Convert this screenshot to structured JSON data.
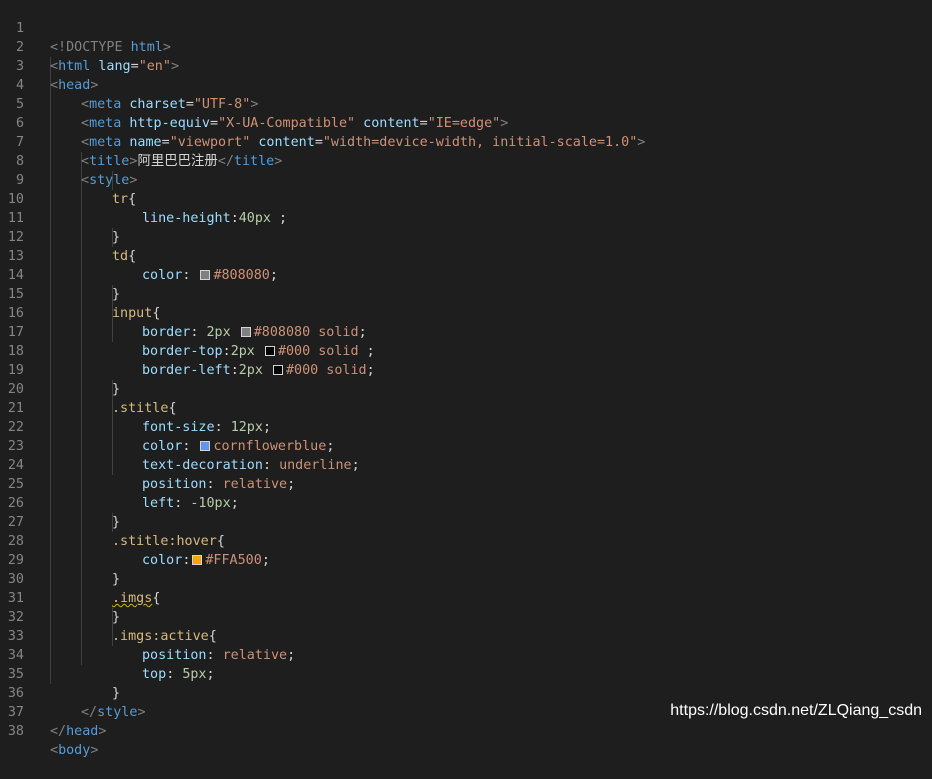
{
  "editor": {
    "line_numbers": [
      "1",
      "2",
      "3",
      "4",
      "5",
      "6",
      "7",
      "8",
      "9",
      "10",
      "11",
      "12",
      "13",
      "14",
      "15",
      "16",
      "17",
      "18",
      "19",
      "20",
      "21",
      "22",
      "23",
      "24",
      "25",
      "26",
      "27",
      "28",
      "29",
      "30",
      "31",
      "32",
      "33",
      "34",
      "35",
      "36",
      "37",
      "38"
    ],
    "colors": {
      "background": "#1e1e1e",
      "tag": "#569cd6",
      "attribute": "#9cdcfe",
      "string": "#ce9178",
      "number": "#b5cea8",
      "selector": "#d7ba7d",
      "text": "#d4d4d4",
      "line_number": "#858585"
    },
    "swatch_colors": {
      "gray": "#808080",
      "black": "#000",
      "cornflowerblue": "#6495ed",
      "orange": "#FFA500"
    },
    "t": {
      "l1_a": "<!DOCTYPE ",
      "l1_b": "html",
      "l1_c": ">",
      "l2_a": "<",
      "l2_b": "html",
      "l2_c": " lang",
      "l2_d": "=",
      "l2_e": "\"en\"",
      "l2_f": ">",
      "l3_a": "<",
      "l3_b": "head",
      "l3_c": ">",
      "l4_a": "<",
      "l4_b": "meta",
      "l4_c": " charset",
      "l4_d": "=",
      "l4_e": "\"UTF-8\"",
      "l4_f": ">",
      "l5_a": "<",
      "l5_b": "meta",
      "l5_c": " http-equiv",
      "l5_d": "=",
      "l5_e": "\"X-UA-Compatible\"",
      "l5_f": " content",
      "l5_g": "=",
      "l5_h": "\"IE=edge\"",
      "l5_i": ">",
      "l6_a": "<",
      "l6_b": "meta",
      "l6_c": " name",
      "l6_d": "=",
      "l6_e": "\"viewport\"",
      "l6_f": " content",
      "l6_g": "=",
      "l6_h": "\"width=device-width, initial-scale=1.0\"",
      "l6_i": ">",
      "l7_a": "<",
      "l7_b": "title",
      "l7_c": ">",
      "l7_d": "阿里巴巴注册",
      "l7_e": "</",
      "l7_f": "title",
      "l7_g": ">",
      "l8_a": "<",
      "l8_b": "style",
      "l8_c": ">",
      "l9_a": "tr",
      "l9_b": "{",
      "l10_a": "line-height",
      "l10_b": ":",
      "l10_c": "40px",
      "l10_d": " ;",
      "l11": "}",
      "l12_a": "td",
      "l12_b": "{",
      "l13_a": "color",
      "l13_b": ": ",
      "l13_c": "#808080",
      "l13_d": ";",
      "l14": "}",
      "l15_a": "input",
      "l15_b": "{",
      "l16_a": "border",
      "l16_b": ": ",
      "l16_c": "2px",
      "l16_d": " ",
      "l16_e": "#808080",
      "l16_f": " solid",
      "l16_g": ";",
      "l17_a": "border-top",
      "l17_b": ":",
      "l17_c": "2px",
      "l17_d": " ",
      "l17_e": "#000",
      "l17_f": " solid",
      "l17_g": " ;",
      "l18_a": "border-left",
      "l18_b": ":",
      "l18_c": "2px",
      "l18_d": " ",
      "l18_e": "#000",
      "l18_f": " solid",
      "l18_g": ";",
      "l19": "}",
      "l20_a": ".stitle",
      "l20_b": "{",
      "l21_a": "font-size",
      "l21_b": ": ",
      "l21_c": "12px",
      "l21_d": ";",
      "l22_a": "color",
      "l22_b": ": ",
      "l22_c": "cornflowerblue",
      "l22_d": ";",
      "l23_a": "text-decoration",
      "l23_b": ": ",
      "l23_c": "underline",
      "l23_d": ";",
      "l24_a": "position",
      "l24_b": ": ",
      "l24_c": "relative",
      "l24_d": ";",
      "l25_a": "left",
      "l25_b": ": ",
      "l25_c": "-10px",
      "l25_d": ";",
      "l26": "}",
      "l27_a": ".stitle:hover",
      "l27_b": "{",
      "l28_a": "color",
      "l28_b": ":",
      "l28_c": "#FFA500",
      "l28_d": ";",
      "l29": "}",
      "l30_a": ".imgs",
      "l30_b": "{",
      "l31": "}",
      "l32_a": ".imgs:active",
      "l32_b": "{",
      "l33_a": "position",
      "l33_b": ": ",
      "l33_c": "relative",
      "l33_d": ";",
      "l34_a": "top",
      "l34_b": ": ",
      "l34_c": "5px",
      "l34_d": ";",
      "l35": "}",
      "l36_a": "</",
      "l36_b": "style",
      "l36_c": ">",
      "l37_a": "</",
      "l37_b": "head",
      "l37_c": ">",
      "l38_a": "<",
      "l38_b": "body",
      "l38_c": ">"
    }
  },
  "watermark": "https://blog.csdn.net/ZLQiang_csdn"
}
